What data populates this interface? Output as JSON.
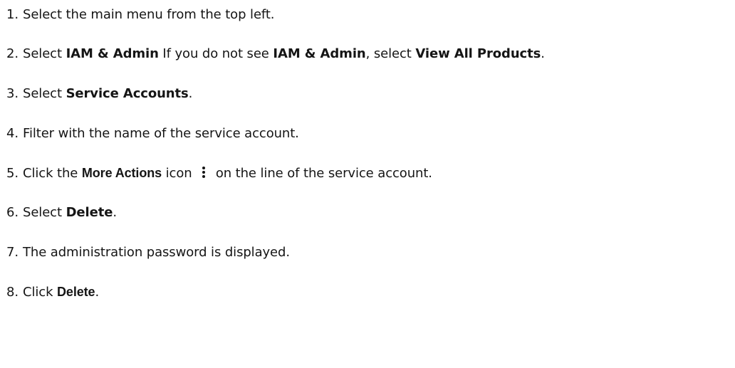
{
  "steps": [
    {
      "num": "1.",
      "segments": [
        "Select the main menu from the top left."
      ]
    },
    {
      "num": "2.",
      "segments": [
        "Select ",
        "IAM & Admin",
        " If you do not see  ",
        "IAM & Admin",
        ", select ",
        "View All Products",
        "."
      ]
    },
    {
      "num": "3.",
      "segments": [
        "Select ",
        "Service Accounts",
        "."
      ]
    },
    {
      "num": "4.",
      "segments": [
        "Filter with the name of the service account."
      ]
    },
    {
      "num": "5.",
      "segments": [
        "Click the ",
        "More Actions",
        " icon ",
        " on the line of the service account."
      ]
    },
    {
      "num": "6.",
      "segments": [
        "Select ",
        "Delete",
        "."
      ]
    },
    {
      "num": "7.",
      "segments": [
        "The administration password is displayed."
      ]
    },
    {
      "num": "8.",
      "segments": [
        "Click ",
        "Delete",
        "."
      ]
    }
  ],
  "icons": {
    "more_actions": "kebab-vertical-icon"
  }
}
